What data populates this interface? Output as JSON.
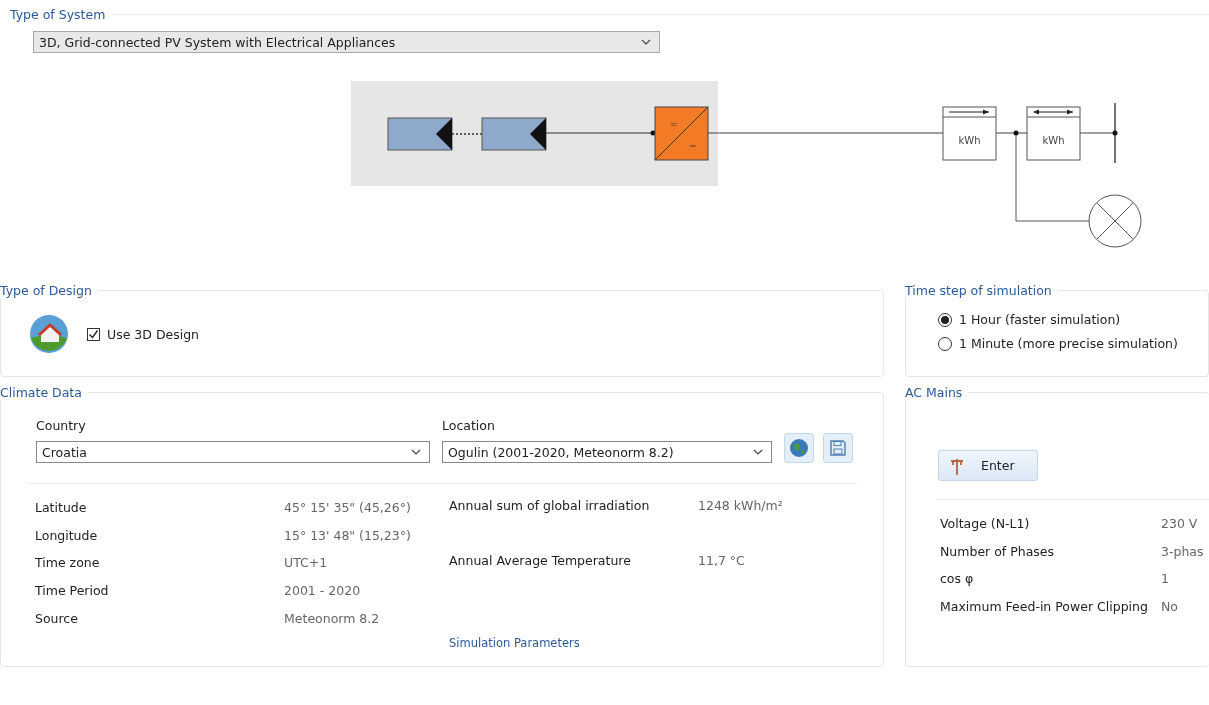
{
  "system_type": {
    "title": "Type of System",
    "value": "3D, Grid-connected PV System with Electrical Appliances"
  },
  "diagram": {
    "inverter_dc": "=",
    "inverter_ac": "~",
    "meters": [
      {
        "label": "kWh",
        "kind": "one-way"
      },
      {
        "label": "kWh",
        "kind": "two-way"
      }
    ]
  },
  "design": {
    "title": "Type of Design",
    "use_3d": {
      "label": "Use 3D Design",
      "checked": true
    }
  },
  "time_step": {
    "title": "Time step of simulation",
    "options": [
      {
        "label": "1 Hour (faster simulation)",
        "selected": true
      },
      {
        "label": "1 Minute (more precise simulation)",
        "selected": false
      }
    ]
  },
  "climate": {
    "title": "Climate Data",
    "country": {
      "label": "Country",
      "value": "Croatia"
    },
    "location": {
      "label": "Location",
      "value": "Ogulin (2001-2020, Meteonorm 8.2)"
    },
    "details": [
      {
        "label": "Latitude",
        "value": "45° 15' 35\"  (45,26°)"
      },
      {
        "label": "Longitude",
        "value": "15° 13' 48\"  (15,23°)"
      },
      {
        "label": "Time zone",
        "value": "UTC+1"
      },
      {
        "label": "Time Period",
        "value": "2001 - 2020"
      },
      {
        "label": "Source",
        "value": "Meteonorm 8.2"
      }
    ],
    "stats": [
      {
        "label": "Annual sum of global irradiation",
        "value": "1248 kWh/m²"
      },
      {
        "label": "Annual Average Temperature",
        "value": "11,7 °C"
      }
    ],
    "link": "Simulation Parameters"
  },
  "ac_mains": {
    "title": "AC Mains",
    "button": "Enter",
    "rows": [
      {
        "label": "Voltage (N-L1)",
        "value": "230 V"
      },
      {
        "label": "Number of Phases",
        "value": "3-phas"
      },
      {
        "label": "cos φ",
        "value": "1"
      },
      {
        "label": "Maximum Feed-in Power Clipping",
        "value": "No"
      }
    ]
  }
}
